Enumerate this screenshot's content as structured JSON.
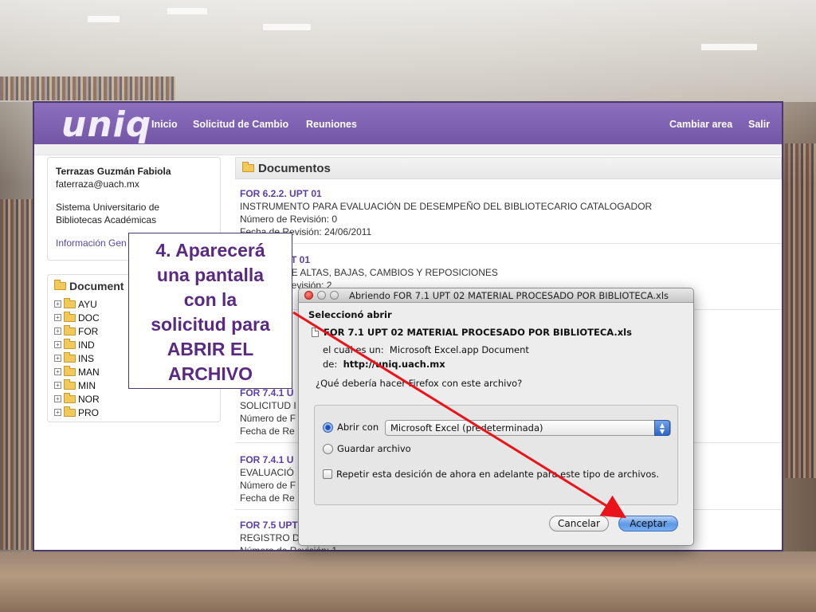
{
  "nav": {
    "logo": "uniq",
    "inicio": "Inicio",
    "solicitud": "Solicitud de Cambio",
    "reuniones": "Reuniones",
    "cambiar_area": "Cambiar area",
    "salir": "Salir"
  },
  "user": {
    "name": "Terrazas Guzmán Fabiola",
    "email": "faterraza@uach.mx",
    "org_line1": "Sistema Universitario de",
    "org_line2": "Bibliotecas Académicas",
    "info_link": "Información Gen"
  },
  "tree": {
    "title": "Document",
    "items": [
      "AYU",
      "DOC",
      "FOR",
      "IND",
      "INS",
      "MAN",
      "MIN",
      "NOR",
      "PRO"
    ]
  },
  "documents": {
    "title": "Documentos",
    "items": [
      {
        "code": "FOR 6.2.2. UPT 01",
        "name": "INSTRUMENTO PARA EVALUACIÓN DE DESEMPEÑO DEL BIBLIOTECARIO CATALOGADOR",
        "rev": "Número de Revisión: 0",
        "date": "Fecha de Revisión: 24/06/2011"
      },
      {
        "code": "PT 01",
        "name": "DE ALTAS, BAJAS, CAMBIOS Y REPOSICIONES",
        "rev": "Revisión: 2",
        "date": ""
      },
      {
        "code": "FOR 7.4.1 U",
        "name": "SOLICITUD I",
        "rev": "Número de F",
        "date": "Fecha de Re"
      },
      {
        "code": "FOR 7.4.1 U",
        "name": "EVALUACIÓ",
        "rev": "Número de F",
        "date": "Fecha de Re"
      },
      {
        "code": "FOR 7.5 UPT",
        "name": "REGISTRO D",
        "rev": "Número de Revisión: 1",
        "date": ""
      }
    ]
  },
  "dialog": {
    "title": "Abriendo FOR 7.1 UPT 02 MATERIAL PROCESADO POR BIBLIOTECA.xls",
    "selected_label": "Seleccionó abrir",
    "filename": "FOR 7.1 UPT 02 MATERIAL PROCESADO POR BIBLIOTECA.xls",
    "type_label": "el cual es un:",
    "type_value": "Microsoft Excel.app Document",
    "from_label": "de:",
    "from_value": "http://uniq.uach.mx",
    "question": "¿Qué debería hacer Firefox con este archivo?",
    "open_with_label": "Abrir con",
    "open_with_value": "Microsoft Excel (predeterminada)",
    "save_label": "Guardar archivo",
    "repeat_label": "Repetir esta desición de ahora en adelante para este tipo de archivos.",
    "cancel_label": "Cancelar",
    "ok_label": "Aceptar"
  },
  "callout": {
    "text": "4. Aparecerá\nuna pantalla\ncon la\nsolicitud para\nABRIR EL\nARCHIVO"
  },
  "colors": {
    "navbar": "#7356a6",
    "link": "#5b3ea6",
    "callout_text": "#5a2a82",
    "arrow": "#e8141a",
    "ok_button": "#5b98e6"
  }
}
